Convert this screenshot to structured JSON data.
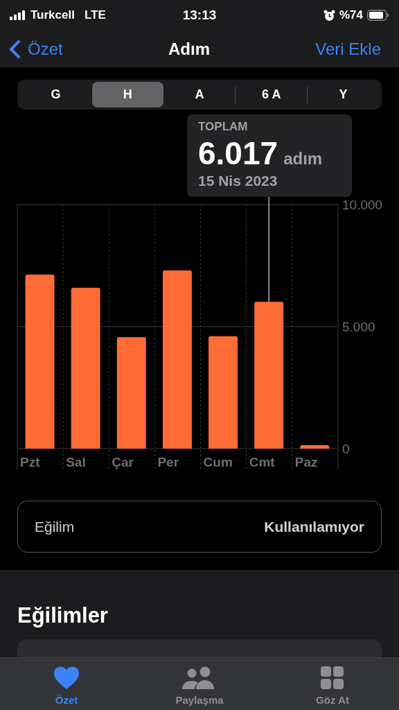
{
  "status_bar": {
    "carrier": "Turkcell",
    "network": "LTE",
    "time": "13:13",
    "battery": "%74"
  },
  "nav": {
    "back": "Özet",
    "title": "Adım",
    "action": "Veri Ekle"
  },
  "segments": [
    {
      "label": "G",
      "selected": false
    },
    {
      "label": "H",
      "selected": true
    },
    {
      "label": "A",
      "selected": false
    },
    {
      "label": "6 A",
      "selected": false
    },
    {
      "label": "Y",
      "selected": false
    }
  ],
  "tooltip": {
    "title": "TOPLAM",
    "value": "6.017",
    "unit": "adım",
    "date": "15 Nis 2023"
  },
  "chart_data": {
    "type": "bar",
    "categories": [
      "Pzt",
      "Sal",
      "Çar",
      "Per",
      "Cum",
      "Cmt",
      "Paz"
    ],
    "series": [
      {
        "color": "#ff6b35",
        "values": [
          7130,
          6590,
          4570,
          7300,
          4600,
          6017,
          140
        ]
      }
    ],
    "annotations": [
      {
        "x": "Cmt"
      }
    ],
    "ylim": [
      0,
      10000
    ],
    "yticks": [
      {
        "value": 10000,
        "label": "10.000"
      },
      {
        "value": 5000,
        "label": "5.000"
      },
      {
        "value": 0,
        "label": "0"
      }
    ]
  },
  "trend_card": {
    "label": "Eğilim",
    "value": "Kullanılamıyor"
  },
  "section_title": "Eğilimler",
  "tab_bar": [
    {
      "label": "Özet",
      "kind": "heart",
      "selected": true
    },
    {
      "label": "Paylaşma",
      "kind": "people",
      "selected": false
    },
    {
      "label": "Göz At",
      "kind": "grid",
      "selected": false
    }
  ]
}
